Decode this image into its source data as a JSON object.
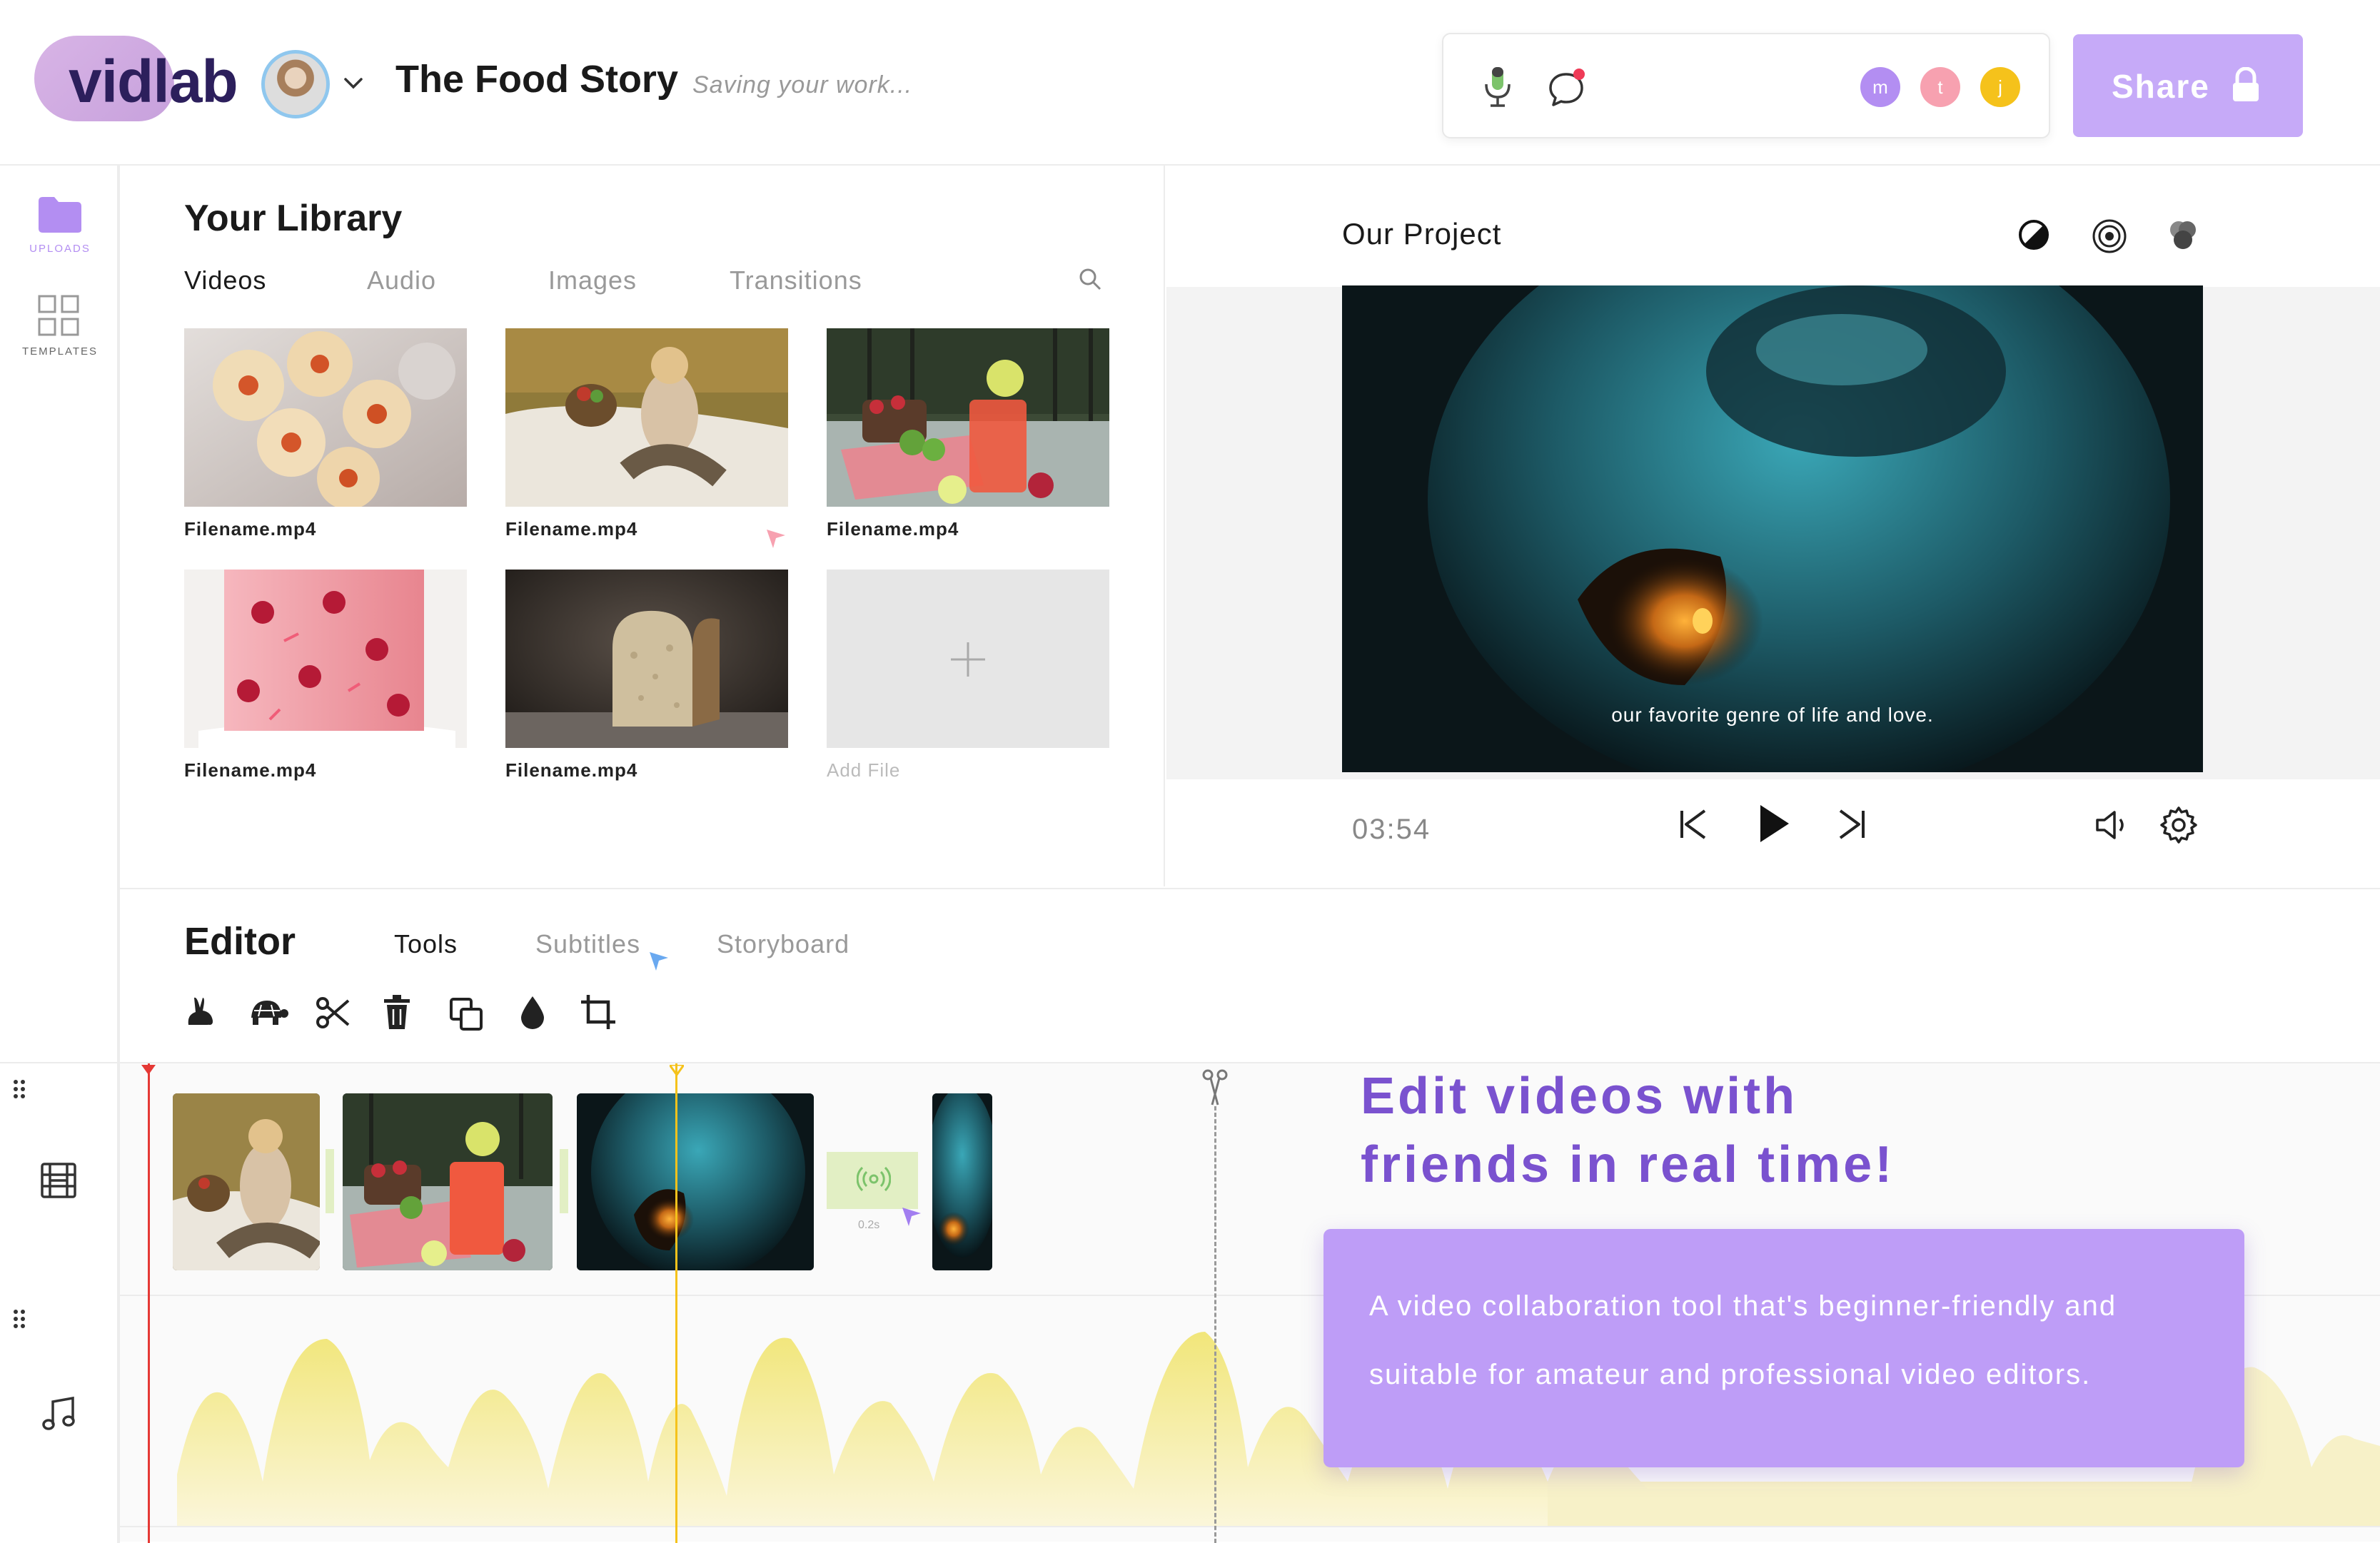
{
  "header": {
    "logo_text": "vidlab",
    "project_title": "The Food Story",
    "status": "Saving your work...",
    "collaborators": [
      {
        "initial": "m",
        "color": "#b38ef2"
      },
      {
        "initial": "t",
        "color": "#f7a1b0"
      },
      {
        "initial": "j",
        "color": "#f5c21b"
      }
    ],
    "share_label": "Share"
  },
  "rail": {
    "uploads_label": "UPLOADS",
    "templates_label": "TEMPLATES",
    "accent": "#b38ef2"
  },
  "library": {
    "title": "Your Library",
    "tabs": [
      "Videos",
      "Audio",
      "Images",
      "Transitions"
    ],
    "files": [
      {
        "name": "Filename.mp4",
        "subject": "cookies"
      },
      {
        "name": "Filename.mp4",
        "subject": "picnic"
      },
      {
        "name": "Filename.mp4",
        "subject": "lemonade"
      },
      {
        "name": "Filename.mp4",
        "subject": "cake"
      },
      {
        "name": "Filename.mp4",
        "subject": "bread"
      }
    ],
    "add_file_label": "Add File"
  },
  "preview": {
    "title": "Our Project",
    "subtitle": "our favorite genre of life and love.",
    "timecode": "03:54"
  },
  "editor": {
    "title": "Editor",
    "tabs": [
      "Tools",
      "Subtitles",
      "Storyboard"
    ],
    "transition_duration": "0.2s"
  },
  "promo": {
    "tagline_line1": "Edit videos with",
    "tagline_line2": "friends in real time!",
    "description_line1": "A video collaboration tool that's beginner-friendly and",
    "description_line2": "suitable for amateur and professional video editors."
  },
  "colors": {
    "accent_purple": "#b38ef2",
    "share_button": "#c6aaf8",
    "tagline": "#7a52cf",
    "playhead_red": "#e53935",
    "playhead_yellow": "#f5c21b",
    "waveform": "#f4ec9c"
  }
}
